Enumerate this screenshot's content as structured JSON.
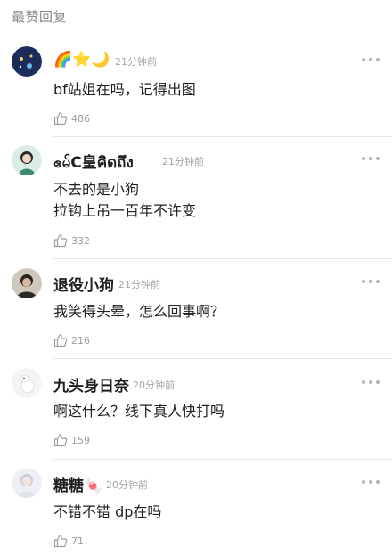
{
  "header": {
    "title": "最赞回复"
  },
  "comments": [
    {
      "username": "🌈⭐🌙",
      "time": "21分钟前",
      "lines": [
        "bf站姐在吗，记得出图"
      ],
      "likes": "486"
    },
    {
      "username": "ဧမ်C皇คิดถึง",
      "time": "21分钟前",
      "lines": [
        "不去的是小狗",
        "拉钩上吊一百年不许变"
      ],
      "likes": "332"
    },
    {
      "username": "退役小狗",
      "time": "21分钟前",
      "lines": [
        "我笑得头晕，怎么回事啊？"
      ],
      "likes": "216"
    },
    {
      "username": "九头身日奈",
      "time": "20分钟前",
      "lines": [
        "啊这什么？线下真人快打吗"
      ],
      "likes": "159"
    },
    {
      "username": "糖糖🍬",
      "time": "20分钟前",
      "lines": [
        "不错不错 dp在吗"
      ],
      "likes": "71"
    }
  ],
  "colors": {
    "divider": "#e6e6e6",
    "muted": "#a5a5a5",
    "text": "#1f1f1f"
  },
  "icons": {
    "like": "thumbs-up-icon",
    "more": "more-dots-icon"
  }
}
